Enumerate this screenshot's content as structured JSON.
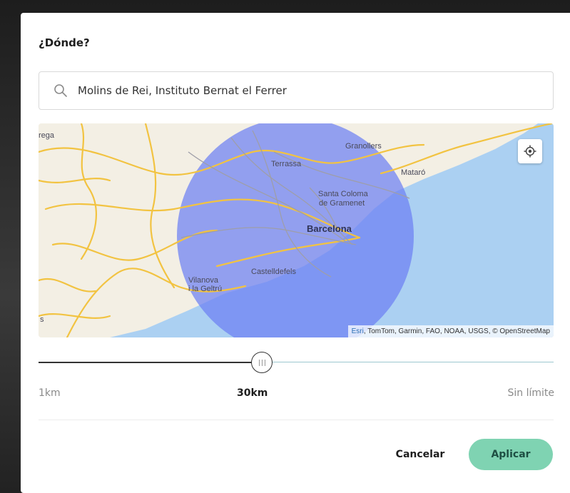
{
  "dialog": {
    "title": "¿Dónde?"
  },
  "search": {
    "value": "Molins de Rei, Instituto Bernat el Ferrer",
    "icon": "search-icon"
  },
  "map": {
    "places": [
      {
        "id": "granollers",
        "name": "Granollers"
      },
      {
        "id": "terrassa",
        "name": "Terrassa"
      },
      {
        "id": "mataro",
        "name": "Mataró"
      },
      {
        "id": "santa-coloma-1",
        "name": "Santa Coloma"
      },
      {
        "id": "santa-coloma-2",
        "name": "de Gramenet"
      },
      {
        "id": "barcelona",
        "name": "Barcelona"
      },
      {
        "id": "castelldefels",
        "name": "Castelldefels"
      },
      {
        "id": "vilanova-1",
        "name": "Vilanova"
      },
      {
        "id": "vilanova-2",
        "name": "i la Geltrú"
      },
      {
        "id": "edge-top",
        "name": "rega"
      },
      {
        "id": "edge-left",
        "name": "s"
      }
    ],
    "locate_icon": "crosshair-icon",
    "attribution_esri": "Esri",
    "attribution_rest": ", TomTom, Garmin, FAO, NOAA, USGS, © OpenStreetMap",
    "colors": {
      "land": "#f3efe4",
      "sea": "#abd0f2",
      "radius": "#7f8ff0",
      "road": "#f2c341"
    }
  },
  "radius": {
    "fraction": 0.433,
    "min_label": "1km",
    "current_label": "30km",
    "max_label": "Sin límite"
  },
  "actions": {
    "cancel": "Cancelar",
    "apply": "Aplicar"
  },
  "colors": {
    "accent": "#7fd3b2",
    "accent_text": "#1e4f43"
  }
}
